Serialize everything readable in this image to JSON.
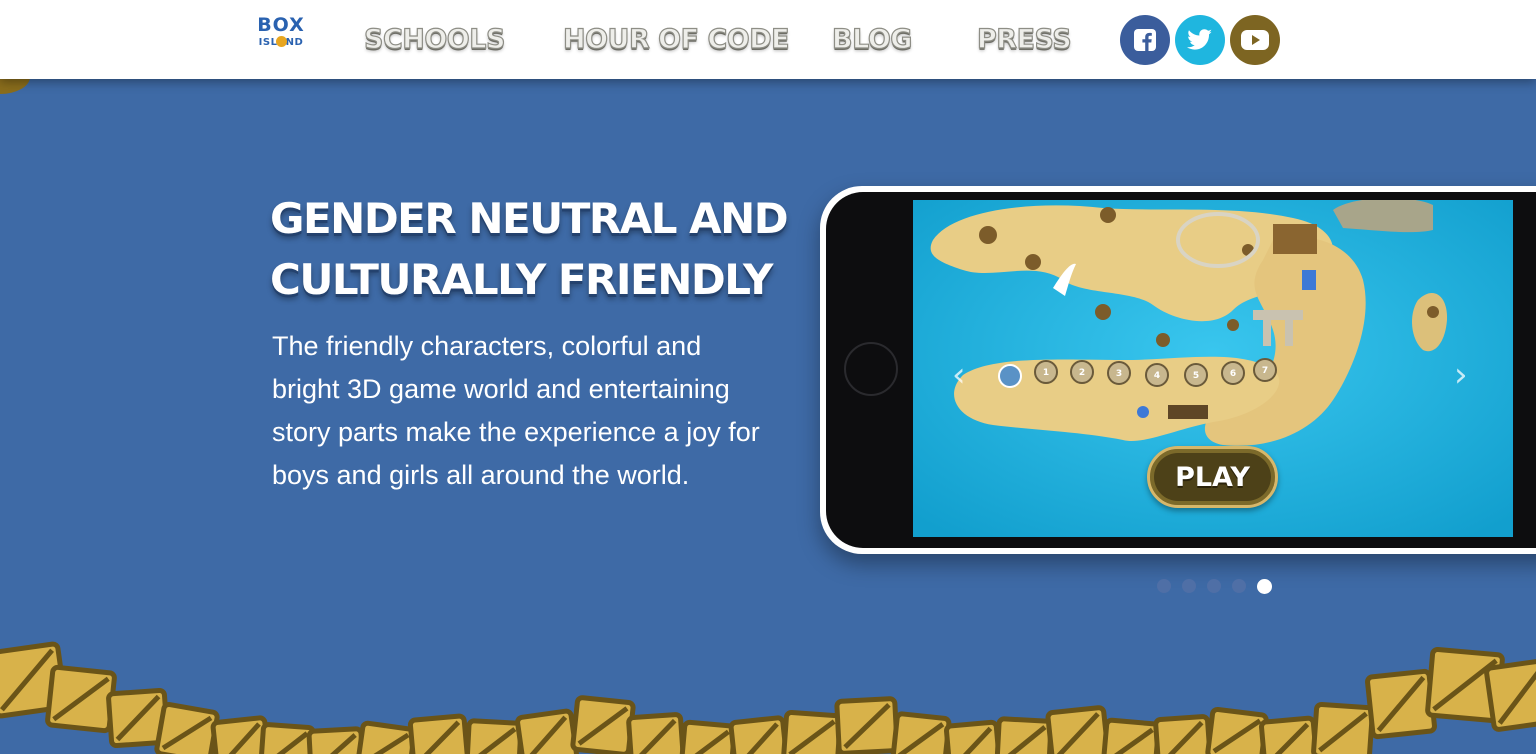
{
  "header": {
    "logo": {
      "line1": "BOX",
      "line2": "ISLAND"
    },
    "nav": [
      {
        "label": "SCHOOLS"
      },
      {
        "label": "HOUR OF CODE"
      },
      {
        "label": "BLOG"
      },
      {
        "label": "PRESS"
      }
    ],
    "social": [
      {
        "icon": "facebook-icon",
        "color": "#3b5d9c"
      },
      {
        "icon": "twitter-icon",
        "color": "#1fb6df"
      },
      {
        "icon": "youtube-icon",
        "color": "#7d6522"
      }
    ]
  },
  "hero": {
    "headline_line1": "GENDER NEUTRAL AND",
    "headline_line2": "CULTURALLY FRIENDLY",
    "description": "The friendly characters, colorful and bright 3D game world and entertaining story parts make the experience a joy for boys and girls all around the world."
  },
  "game": {
    "play_label": "PLAY",
    "levels": [
      "1",
      "2",
      "3",
      "4",
      "5",
      "6",
      "7"
    ],
    "prev_arrow": "‹",
    "next_arrow": "›"
  },
  "carousel": {
    "slide_count": 5,
    "active_index": 5
  },
  "colors": {
    "background": "#3e6aa6",
    "sea": "#1fb4dc",
    "sand": "#e8cd86",
    "crate": "#d8b24a",
    "crate_dark": "#6a5418"
  }
}
